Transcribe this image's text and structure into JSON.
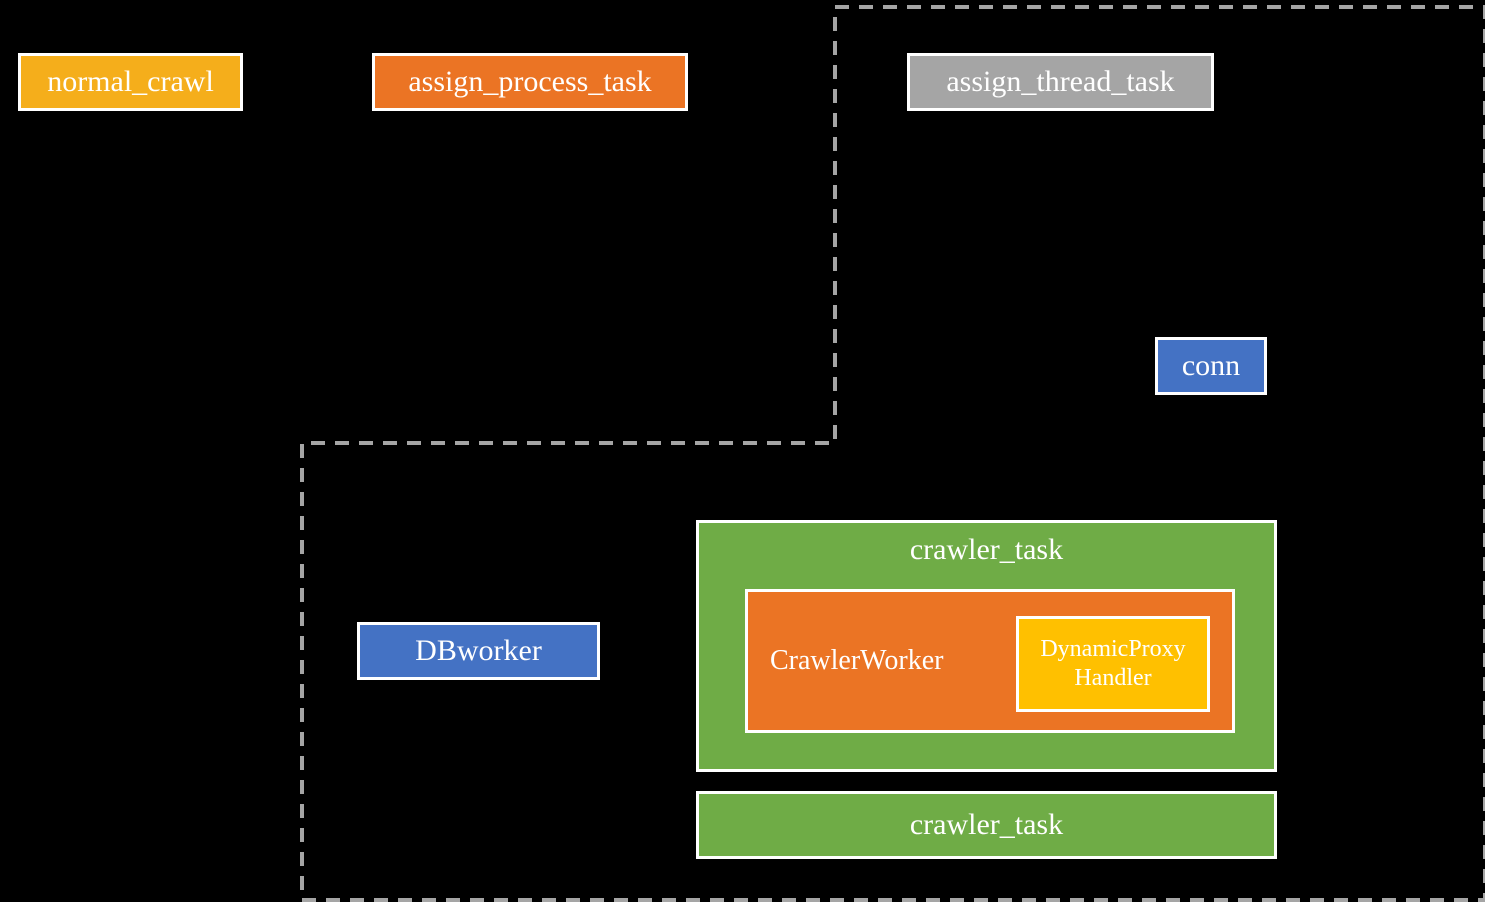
{
  "boxes": {
    "normal_crawl": "normal_crawl",
    "assign_process_task": "assign_process_task",
    "assign_thread_task": "assign_thread_task",
    "conn": "conn",
    "dbworker": "DBworker",
    "crawler_task_1_title": "crawler_task",
    "crawler_worker": "CrawlerWorker",
    "dynamic_proxy_l1": "DynamicProxy",
    "dynamic_proxy_l2": "Handler",
    "crawler_task_2": "crawler_task"
  },
  "colors": {
    "yellow": "#F5AE1B",
    "orange": "#EB7424",
    "gray": "#A5A5A5",
    "blue": "#4472C4",
    "green": "#6FAC46",
    "gold": "#FFC000",
    "dashBorder": "#A5A5A5"
  }
}
